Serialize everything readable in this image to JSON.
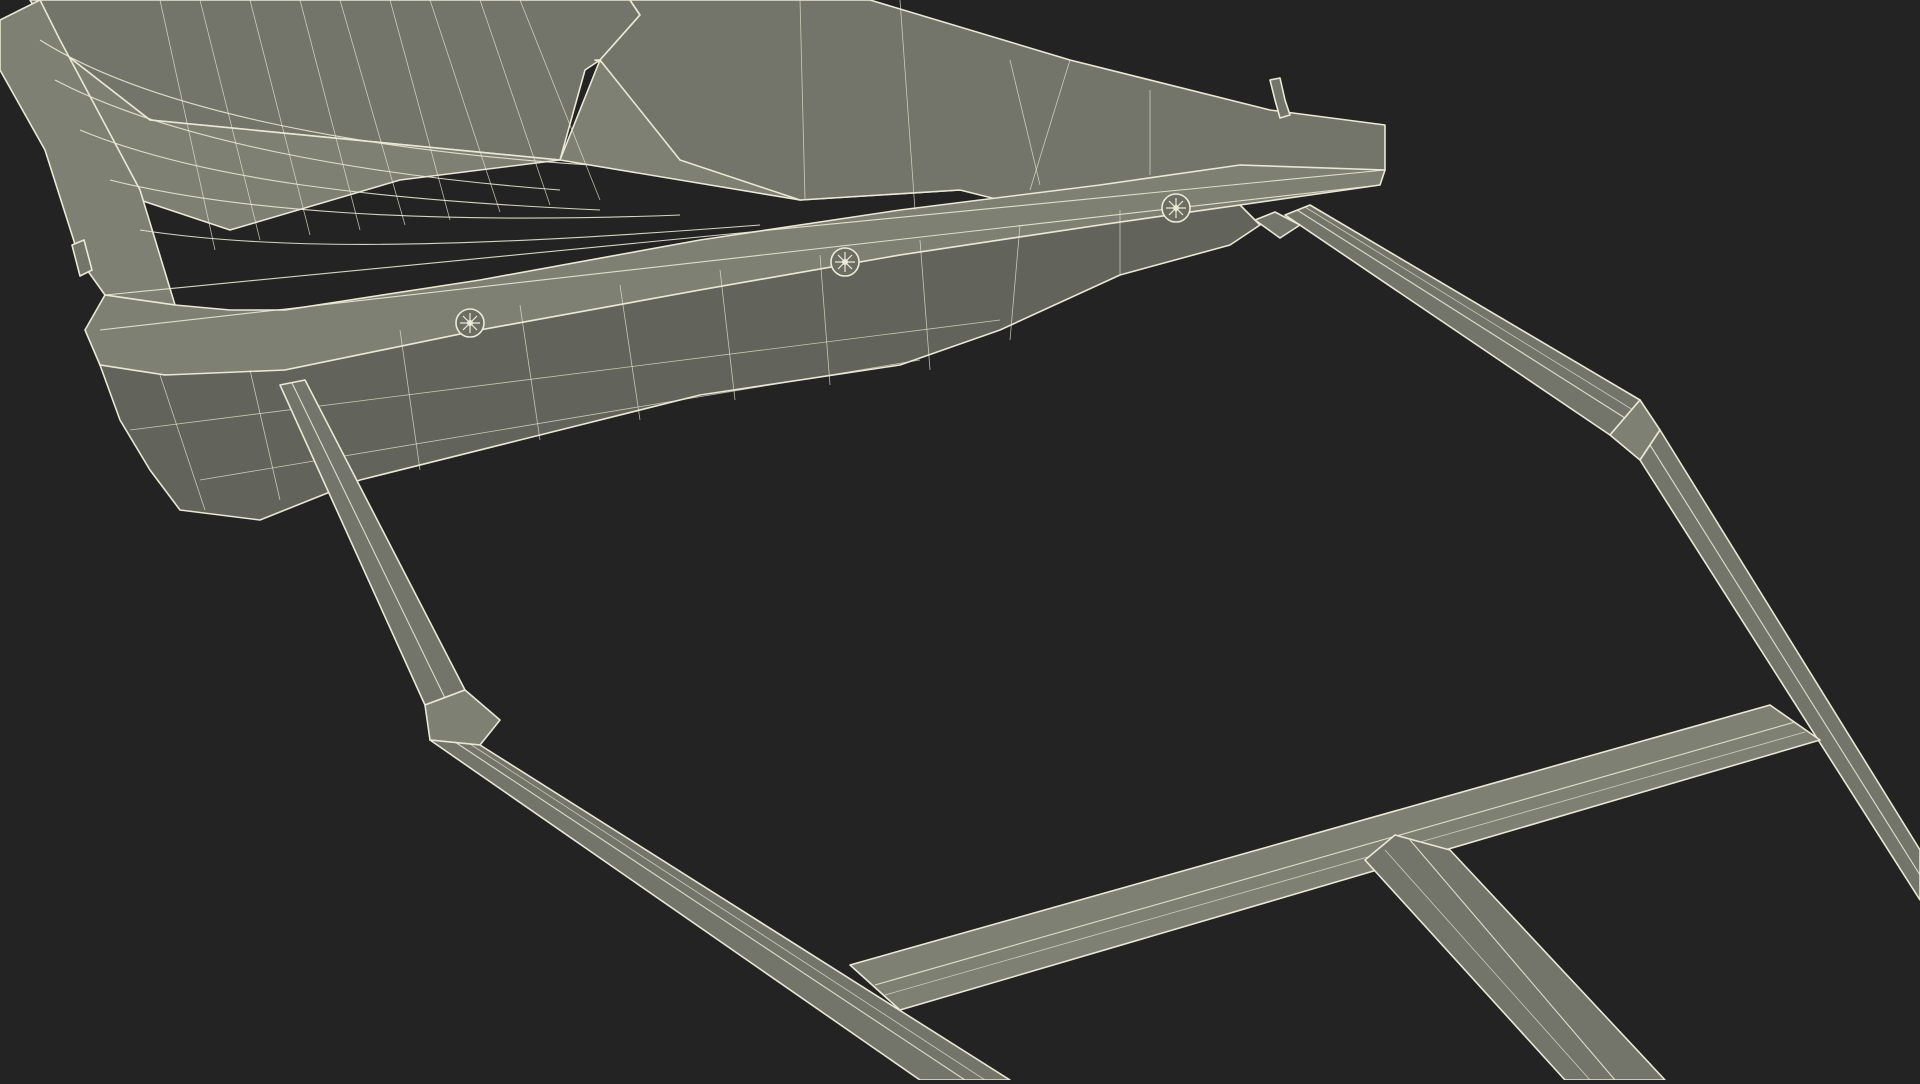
{
  "colors": {
    "background": "#232323",
    "surface": "#74756a",
    "wireframe": "#e9e8d4"
  },
  "scene": {
    "subject": "sled-wireframe-render"
  }
}
